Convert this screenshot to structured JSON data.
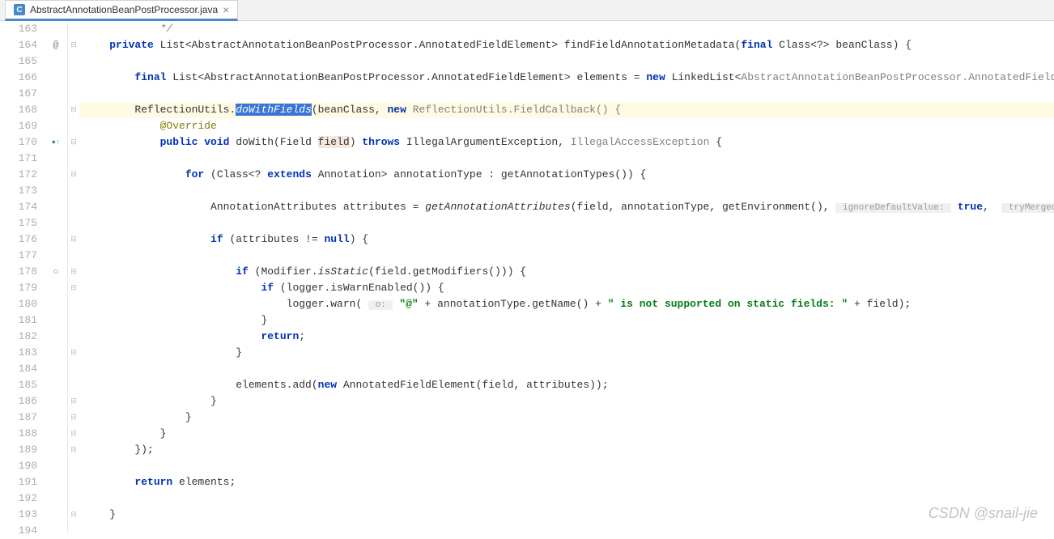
{
  "tab": {
    "filename": "AbstractAnnotationBeanPostProcessor.java",
    "iconLetter": "C"
  },
  "watermark": "CSDN @snail-jie",
  "lineStart": 163,
  "lineEnd": 194,
  "marks": {
    "164": "@",
    "170": "green",
    "178": "red"
  },
  "foldRows": [
    164,
    168,
    170,
    172,
    176,
    178,
    179,
    183,
    186,
    187,
    188,
    189,
    193
  ],
  "selectedToken": "doWithFields",
  "code": {
    "163": {
      "indent": 12,
      "tokens": [
        {
          "t": "*/",
          "c": "cmt"
        }
      ]
    },
    "164": {
      "indent": 4,
      "tokens": [
        {
          "t": "private ",
          "c": "kw"
        },
        {
          "t": "List<AbstractAnnotationBeanPostProcessor.AnnotatedFieldElement> findFieldAnnotationMetadata(",
          "c": ""
        },
        {
          "t": "final ",
          "c": "kw"
        },
        {
          "t": "Class<?> beanClass) {",
          "c": ""
        }
      ]
    },
    "165": {
      "indent": 0,
      "tokens": []
    },
    "166": {
      "indent": 8,
      "tokens": [
        {
          "t": "final ",
          "c": "kw"
        },
        {
          "t": "List<AbstractAnnotationBeanPostProcessor.AnnotatedFieldElement> elements = ",
          "c": ""
        },
        {
          "t": "new ",
          "c": "kw"
        },
        {
          "t": "LinkedList<",
          "c": ""
        },
        {
          "t": "AbstractAnnotationBeanPostProcessor.AnnotatedFieldElement",
          "c": "generic"
        },
        {
          "t": ">();",
          "c": ""
        }
      ]
    },
    "167": {
      "indent": 0,
      "tokens": []
    },
    "168": {
      "indent": 8,
      "hl": true,
      "tokens": [
        {
          "t": "ReflectionUtils.",
          "c": ""
        },
        {
          "t": "doWithFields",
          "c": "sel italic"
        },
        {
          "t": "(beanClass, ",
          "c": ""
        },
        {
          "t": "new ",
          "c": "kw"
        },
        {
          "t": "ReflectionUtils.FieldCallback() {",
          "c": "generic"
        }
      ]
    },
    "169": {
      "indent": 12,
      "tokens": [
        {
          "t": "@Override",
          "c": "ann"
        }
      ]
    },
    "170": {
      "indent": 12,
      "tokens": [
        {
          "t": "public void ",
          "c": "kw"
        },
        {
          "t": "doWith(Field ",
          "c": ""
        },
        {
          "t": "field",
          "c": "ident-def"
        },
        {
          "t": ") ",
          "c": ""
        },
        {
          "t": "throws ",
          "c": "kw"
        },
        {
          "t": "IllegalArgumentException, ",
          "c": ""
        },
        {
          "t": "IllegalAccessException ",
          "c": "generic"
        },
        {
          "t": "{",
          "c": ""
        }
      ]
    },
    "171": {
      "indent": 0,
      "tokens": []
    },
    "172": {
      "indent": 16,
      "tokens": [
        {
          "t": "for ",
          "c": "kw"
        },
        {
          "t": "(Class<? ",
          "c": ""
        },
        {
          "t": "extends ",
          "c": "kw"
        },
        {
          "t": "Annotation> annotationType : getAnnotationTypes()) {",
          "c": ""
        }
      ]
    },
    "173": {
      "indent": 0,
      "tokens": []
    },
    "174": {
      "indent": 20,
      "tokens": [
        {
          "t": "AnnotationAttributes attributes = ",
          "c": ""
        },
        {
          "t": "getAnnotationAttributes",
          "c": "italic"
        },
        {
          "t": "(field, annotationType, getEnvironment(), ",
          "c": ""
        },
        {
          "t": " ignoreDefaultValue: ",
          "c": "hint"
        },
        {
          "t": " ",
          "c": ""
        },
        {
          "t": "true",
          "c": "lit"
        },
        {
          "t": ",  ",
          "c": ""
        },
        {
          "t": " tryMergedAnnotation: ",
          "c": "hint"
        },
        {
          "t": " ",
          "c": ""
        },
        {
          "t": "true",
          "c": "lit"
        },
        {
          "t": ");",
          "c": ""
        }
      ]
    },
    "175": {
      "indent": 0,
      "tokens": []
    },
    "176": {
      "indent": 20,
      "tokens": [
        {
          "t": "if ",
          "c": "kw"
        },
        {
          "t": "(attributes != ",
          "c": ""
        },
        {
          "t": "null",
          "c": "kw"
        },
        {
          "t": ") {",
          "c": ""
        }
      ]
    },
    "177": {
      "indent": 0,
      "tokens": []
    },
    "178": {
      "indent": 24,
      "tokens": [
        {
          "t": "if ",
          "c": "kw"
        },
        {
          "t": "(Modifier.",
          "c": ""
        },
        {
          "t": "isStatic",
          "c": "italic"
        },
        {
          "t": "(field.getModifiers())) {",
          "c": ""
        }
      ]
    },
    "179": {
      "indent": 28,
      "tokens": [
        {
          "t": "if ",
          "c": "kw"
        },
        {
          "t": "(logger.isWarnEnabled()) {",
          "c": ""
        }
      ]
    },
    "180": {
      "indent": 32,
      "tokens": [
        {
          "t": "logger.warn( ",
          "c": ""
        },
        {
          "t": " o: ",
          "c": "hint"
        },
        {
          "t": " ",
          "c": ""
        },
        {
          "t": "\"@\"",
          "c": "str"
        },
        {
          "t": " + annotationType.getName() + ",
          "c": ""
        },
        {
          "t": "\" is not supported on static fields: \"",
          "c": "str"
        },
        {
          "t": " + field);",
          "c": ""
        }
      ]
    },
    "181": {
      "indent": 28,
      "tokens": [
        {
          "t": "}",
          "c": ""
        }
      ]
    },
    "182": {
      "indent": 28,
      "tokens": [
        {
          "t": "return",
          "c": "kw"
        },
        {
          "t": ";",
          "c": ""
        }
      ]
    },
    "183": {
      "indent": 24,
      "tokens": [
        {
          "t": "}",
          "c": ""
        }
      ]
    },
    "184": {
      "indent": 0,
      "tokens": []
    },
    "185": {
      "indent": 24,
      "tokens": [
        {
          "t": "elements.add(",
          "c": ""
        },
        {
          "t": "new ",
          "c": "kw"
        },
        {
          "t": "AnnotatedFieldElement(field, attributes));",
          "c": ""
        }
      ]
    },
    "186": {
      "indent": 20,
      "tokens": [
        {
          "t": "}",
          "c": ""
        }
      ]
    },
    "187": {
      "indent": 16,
      "tokens": [
        {
          "t": "}",
          "c": ""
        }
      ]
    },
    "188": {
      "indent": 12,
      "tokens": [
        {
          "t": "}",
          "c": ""
        }
      ]
    },
    "189": {
      "indent": 8,
      "tokens": [
        {
          "t": "});",
          "c": ""
        }
      ]
    },
    "190": {
      "indent": 0,
      "tokens": []
    },
    "191": {
      "indent": 8,
      "tokens": [
        {
          "t": "return ",
          "c": "kw"
        },
        {
          "t": "elements;",
          "c": ""
        }
      ]
    },
    "192": {
      "indent": 0,
      "tokens": []
    },
    "193": {
      "indent": 4,
      "tokens": [
        {
          "t": "}",
          "c": ""
        }
      ]
    },
    "194": {
      "indent": 0,
      "tokens": []
    }
  }
}
